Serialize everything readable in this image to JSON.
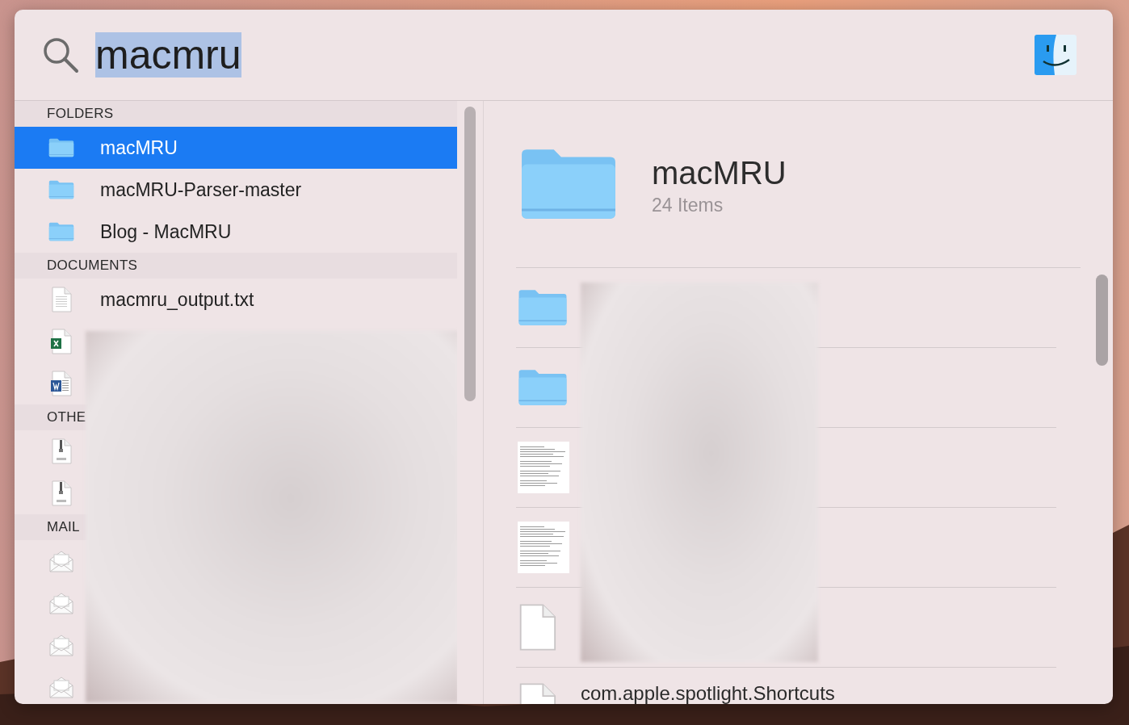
{
  "search": {
    "value": "macmru",
    "text_selected": true
  },
  "results": [
    {
      "title": "FOLDERS",
      "items": [
        {
          "kind": "folder",
          "label": "macMRU",
          "selected": true
        },
        {
          "kind": "folder",
          "label": "macMRU-Parser-master",
          "selected": false
        },
        {
          "kind": "folder",
          "label": "Blog - MacMRU",
          "selected": false
        }
      ]
    },
    {
      "title": "DOCUMENTS",
      "items": [
        {
          "kind": "text",
          "label": "macmru_output.txt",
          "selected": false
        },
        {
          "kind": "excel",
          "selected": false
        },
        {
          "kind": "word",
          "selected": false
        }
      ]
    },
    {
      "title": "OTHE",
      "items": [
        {
          "kind": "zip",
          "selected": false
        },
        {
          "kind": "zip",
          "selected": false
        }
      ]
    },
    {
      "title": "MAIL",
      "items": [
        {
          "kind": "mail",
          "selected": false
        },
        {
          "kind": "mail",
          "selected": false
        },
        {
          "kind": "mail",
          "selected": false
        },
        {
          "kind": "mail",
          "selected": false
        }
      ]
    }
  ],
  "preview": {
    "title": "macMRU",
    "subtitle": "24 Items",
    "contents": [
      {
        "kind": "folder"
      },
      {
        "kind": "folder"
      },
      {
        "kind": "thumb"
      },
      {
        "kind": "thumb"
      },
      {
        "kind": "blank"
      },
      {
        "kind": "blank",
        "label": "com.apple.spotlight.Shortcuts"
      }
    ]
  }
}
